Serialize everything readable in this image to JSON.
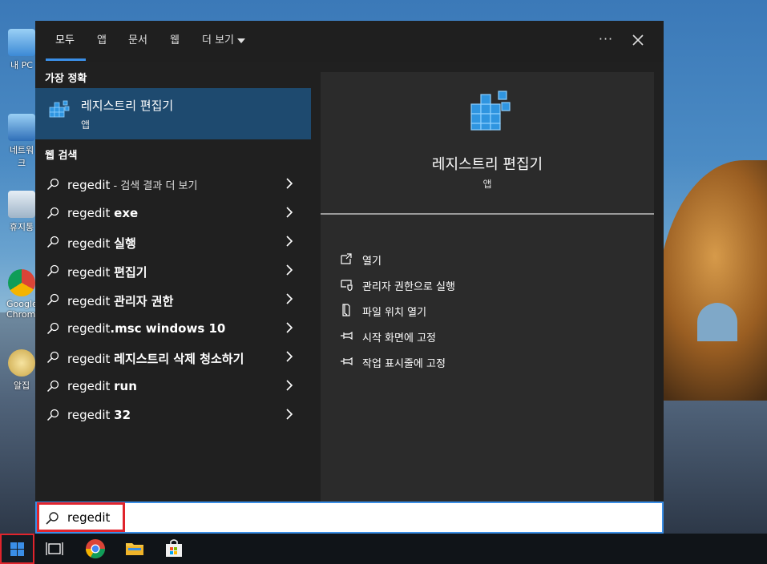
{
  "desktop_icons": [
    {
      "label": "내 PC",
      "icon": "computer-icon"
    },
    {
      "label": "네트워크",
      "icon": "network-icon"
    },
    {
      "label": "휴지통",
      "icon": "recycle-bin-icon"
    },
    {
      "label": "Google Chrome",
      "icon": "chrome-icon"
    },
    {
      "label": "알집",
      "icon": "alzip-icon"
    }
  ],
  "tabs": [
    {
      "label": "모두",
      "active": true
    },
    {
      "label": "앱"
    },
    {
      "label": "문서"
    },
    {
      "label": "웹"
    },
    {
      "label": "더 보기"
    }
  ],
  "header": {
    "more_label": "···",
    "close_label": "✕"
  },
  "best_match": {
    "section_label": "가장 정확",
    "title": "레지스트리 편집기",
    "subtitle": "앱"
  },
  "web_search": {
    "section_label": "웹 검색",
    "items": [
      {
        "prefix": "regedit",
        "bold": "",
        "hint": " - 검색 결과 더 보기"
      },
      {
        "prefix": "regedit ",
        "bold": "exe",
        "hint": ""
      },
      {
        "prefix": "regedit ",
        "bold": "실행",
        "hint": ""
      },
      {
        "prefix": "regedit ",
        "bold": "편집기",
        "hint": ""
      },
      {
        "prefix": "regedit ",
        "bold": "관리자 권한",
        "hint": ""
      },
      {
        "prefix": "regedit",
        "bold": ".msc windows 10",
        "hint": ""
      },
      {
        "prefix": "regedit ",
        "bold": "레지스트리 삭제 청소하기",
        "hint": ""
      },
      {
        "prefix": "regedit ",
        "bold": "run",
        "hint": ""
      },
      {
        "prefix": "regedit ",
        "bold": "32",
        "hint": ""
      }
    ]
  },
  "detail": {
    "app_name": "레지스트리 편집기",
    "app_type": "앱",
    "actions": [
      {
        "label": "열기",
        "icon": "open-icon"
      },
      {
        "label": "관리자 권한으로 실행",
        "icon": "shield-icon"
      },
      {
        "label": "파일 위치 열기",
        "icon": "file-location-icon"
      },
      {
        "label": "시작 화면에 고정",
        "icon": "pin-icon"
      },
      {
        "label": "작업 표시줄에 고정",
        "icon": "pin-icon"
      }
    ]
  },
  "search": {
    "value": "regedit"
  },
  "colors": {
    "accent": "#3a8ee6",
    "highlight": "#e0242c",
    "selected_row": "#1e4a6f"
  }
}
